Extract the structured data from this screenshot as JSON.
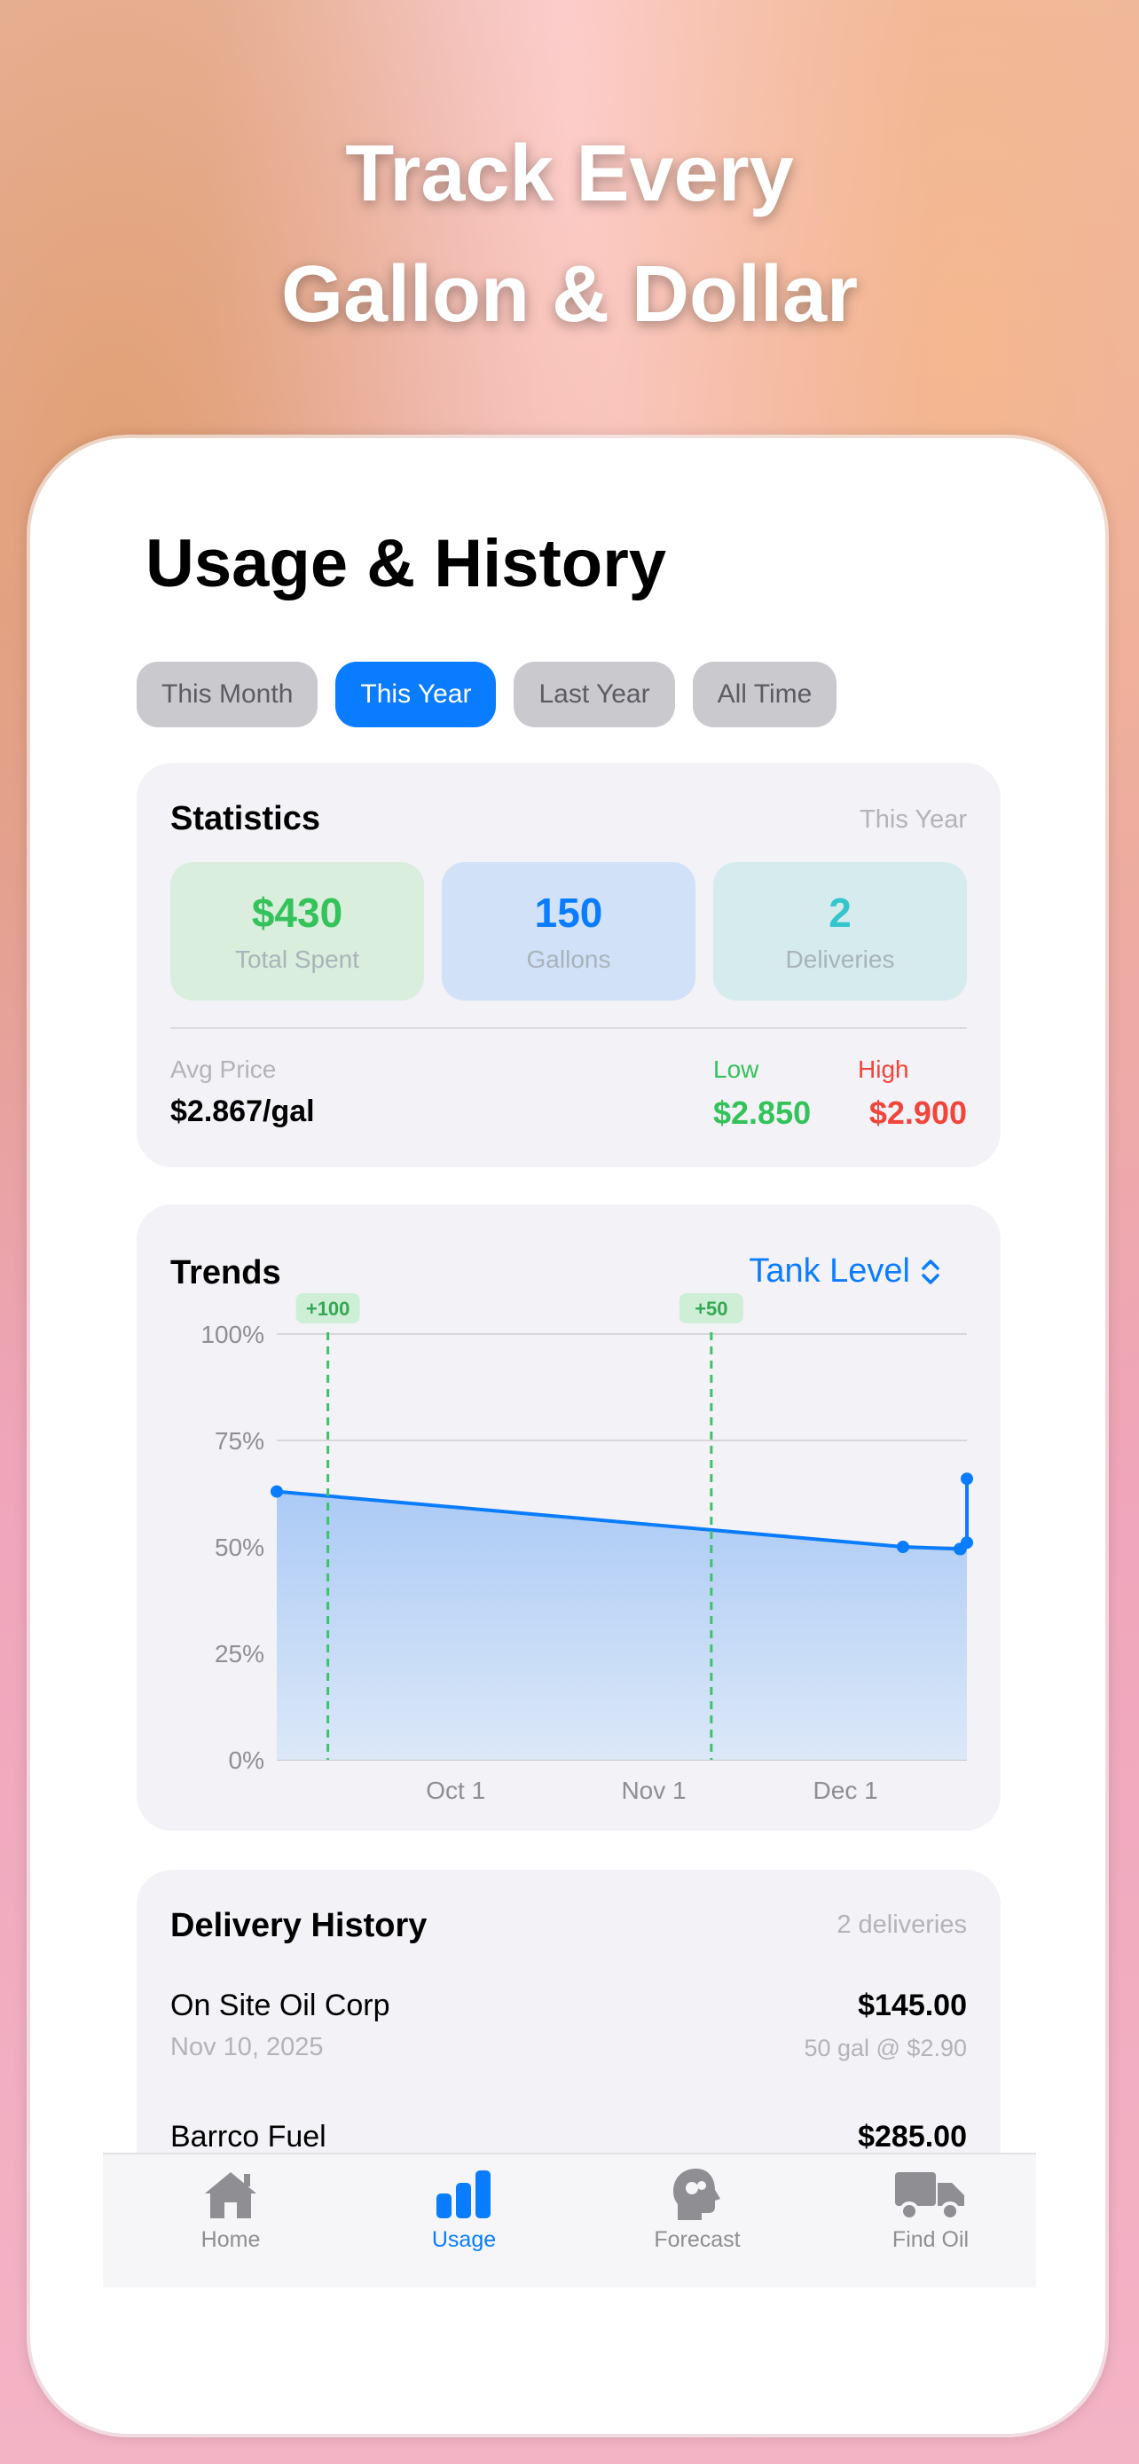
{
  "hero": {
    "line1": "Track Every",
    "line2": "Gallon & Dollar"
  },
  "page_title": "Usage & History",
  "segments": [
    {
      "label": "This Month",
      "active": false
    },
    {
      "label": "This Year",
      "active": true
    },
    {
      "label": "Last Year",
      "active": false
    },
    {
      "label": "All Time",
      "active": false
    }
  ],
  "statistics": {
    "title": "Statistics",
    "period": "This Year",
    "total_spent": {
      "value": "$430",
      "label": "Total Spent"
    },
    "gallons": {
      "value": "150",
      "label": "Gallons"
    },
    "deliveries": {
      "value": "2",
      "label": "Deliveries"
    },
    "avg_price_label": "Avg Price",
    "avg_price_value": "$2.867/gal",
    "low_label": "Low",
    "low_value": "$2.850",
    "high_label": "High",
    "high_value": "$2.900"
  },
  "trends": {
    "title": "Trends",
    "selector_label": "Tank Level"
  },
  "chart_data": {
    "type": "area",
    "title": "",
    "xlabel": "",
    "ylabel": "",
    "y_tick_labels": [
      "100%",
      "75%",
      "50%",
      "25%",
      "0%"
    ],
    "x_tick_labels": [
      "Oct 1",
      "Nov 1",
      "Dec 1"
    ],
    "x": [
      "2025-09-03",
      "2025-12-10",
      "2025-12-19",
      "2025-12-20",
      "2025-12-20"
    ],
    "y": [
      63,
      50,
      49.5,
      51,
      66
    ],
    "ylim": [
      0,
      100
    ],
    "xlim": [
      "2025-09-03",
      "2025-12-20"
    ],
    "grid": true,
    "delivery_markers": [
      {
        "date": "2025-09-11",
        "label": "+100"
      },
      {
        "date": "2025-11-10",
        "label": "+50"
      }
    ],
    "colors": {
      "line": "#0a7cff",
      "fill": "#b9d3f7",
      "marker": "#3cc36a"
    }
  },
  "delivery_history": {
    "title": "Delivery History",
    "count_label": "2 deliveries",
    "items": [
      {
        "vendor": "On Site Oil Corp",
        "date": "Nov 10, 2025",
        "amount": "$145.00",
        "detail": "50 gal @ $2.90"
      },
      {
        "vendor": "Barrco Fuel",
        "amount": "$285.00"
      }
    ]
  },
  "tabbar": [
    {
      "label": "Home",
      "icon": "house-icon",
      "active": false
    },
    {
      "label": "Usage",
      "icon": "bar-chart-icon",
      "active": true
    },
    {
      "label": "Forecast",
      "icon": "brain-head-icon",
      "active": false
    },
    {
      "label": "Find Oil",
      "icon": "delivery-truck-icon",
      "active": false
    }
  ]
}
